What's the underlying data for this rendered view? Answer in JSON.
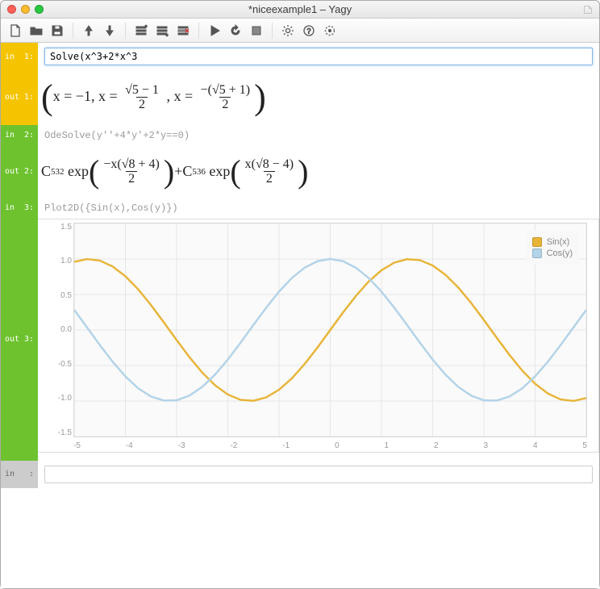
{
  "window": {
    "title": "*niceexample1 – Yagy"
  },
  "toolbar": {
    "new": "New",
    "open": "Open",
    "save": "Save",
    "up": "Up",
    "down": "Down",
    "ins_above": "Insert above",
    "ins_below": "Insert below",
    "delete": "Delete",
    "run": "Run",
    "reload": "Reload",
    "stop": "Stop",
    "settings": "Settings",
    "help": "Help",
    "target": "Target"
  },
  "cells": {
    "in1": {
      "label": "in  1:",
      "value": "Solve(x^3+2*x^3"
    },
    "out1": {
      "label": "out 1:",
      "x1": "x = −1",
      "frac1_num": "√5 − 1",
      "frac1_den": "2",
      "frac2_num": "−(√5 + 1)",
      "frac2_den": "2",
      "x_prefix": "x ="
    },
    "in2": {
      "label": "in  2:",
      "code": "OdeSolve(y''+4*y'+2*y==0)"
    },
    "out2": {
      "label": "out 2:",
      "c1": "C",
      "c1sub": "532",
      "exp": "exp",
      "e1_num": "−x(√8 + 4)",
      "e1_den": "2",
      "plus": " + ",
      "c2": "C",
      "c2sub": "536",
      "e2_num": "x(√8 − 4)",
      "e2_den": "2"
    },
    "in3": {
      "label": "in  3:",
      "code": "Plot2D({Sin(x),Cos(y)})"
    },
    "out3": {
      "label": "out 3:"
    },
    "blank": {
      "label": "in   :",
      "value": ""
    }
  },
  "chart_data": {
    "type": "line",
    "xlim": [
      -5,
      5
    ],
    "ylim": [
      -1.5,
      1.5
    ],
    "xticks": [
      -5,
      -4,
      -3,
      -2,
      -1,
      0,
      1,
      2,
      3,
      4,
      5
    ],
    "yticks": [
      -1.5,
      -1.0,
      -0.5,
      0.0,
      0.5,
      1.0,
      1.5
    ],
    "series": [
      {
        "name": "Sin(x)",
        "color": "#e8b438",
        "x": [
          -5.0,
          -4.75,
          -4.5,
          -4.25,
          -4.0,
          -3.75,
          -3.5,
          -3.25,
          -3.0,
          -2.75,
          -2.5,
          -2.25,
          -2.0,
          -1.75,
          -1.5,
          -1.25,
          -1.0,
          -0.75,
          -0.5,
          -0.25,
          0.0,
          0.25,
          0.5,
          0.75,
          1.0,
          1.25,
          1.5,
          1.75,
          2.0,
          2.25,
          2.5,
          2.75,
          3.0,
          3.25,
          3.5,
          3.75,
          4.0,
          4.25,
          4.5,
          4.75,
          5.0
        ],
        "y": [
          0.959,
          0.999,
          0.978,
          0.895,
          0.757,
          0.572,
          0.351,
          0.108,
          -0.141,
          -0.382,
          -0.599,
          -0.778,
          -0.909,
          -0.984,
          -0.997,
          -0.949,
          -0.841,
          -0.682,
          -0.479,
          -0.247,
          0.0,
          0.247,
          0.479,
          0.682,
          0.841,
          0.949,
          0.997,
          0.984,
          0.909,
          0.778,
          0.599,
          0.382,
          0.141,
          -0.108,
          -0.351,
          -0.572,
          -0.757,
          -0.895,
          -0.978,
          -0.999,
          -0.959
        ]
      },
      {
        "name": "Cos(y)",
        "color": "#b3d3e8",
        "x": [
          -5.0,
          -4.75,
          -4.5,
          -4.25,
          -4.0,
          -3.75,
          -3.5,
          -3.25,
          -3.0,
          -2.75,
          -2.5,
          -2.25,
          -2.0,
          -1.75,
          -1.5,
          -1.25,
          -1.0,
          -0.75,
          -0.5,
          -0.25,
          0.0,
          0.25,
          0.5,
          0.75,
          1.0,
          1.25,
          1.5,
          1.75,
          2.0,
          2.25,
          2.5,
          2.75,
          3.0,
          3.25,
          3.5,
          3.75,
          4.0,
          4.25,
          4.5,
          4.75,
          5.0
        ],
        "y": [
          0.284,
          0.037,
          -0.211,
          -0.446,
          -0.654,
          -0.821,
          -0.936,
          -0.994,
          -0.99,
          -0.924,
          -0.801,
          -0.628,
          -0.416,
          -0.178,
          0.071,
          0.315,
          0.54,
          0.732,
          0.878,
          0.969,
          1.0,
          0.969,
          0.878,
          0.732,
          0.54,
          0.315,
          0.071,
          -0.178,
          -0.416,
          -0.628,
          -0.801,
          -0.924,
          -0.99,
          -0.994,
          -0.936,
          -0.821,
          -0.654,
          -0.446,
          -0.211,
          0.037,
          0.284
        ]
      }
    ],
    "legend_pos": "top-right"
  }
}
